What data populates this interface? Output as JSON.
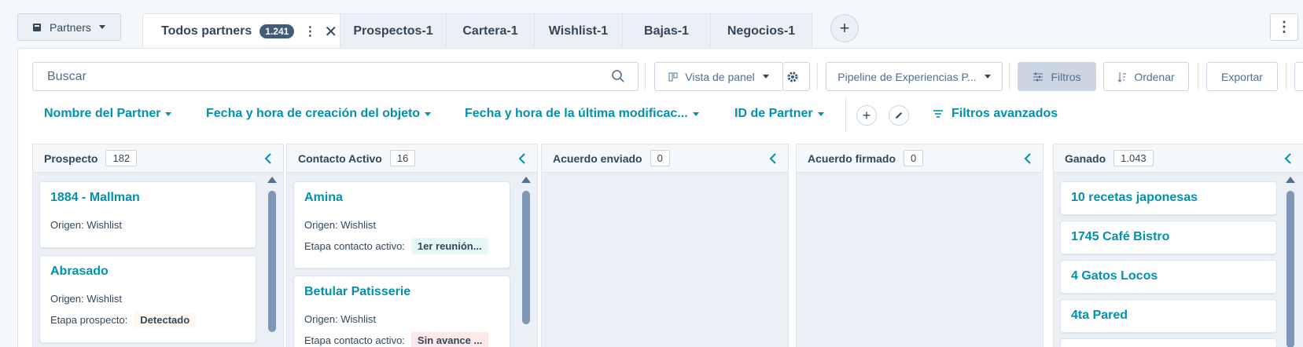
{
  "object_selector": {
    "label": "Partners"
  },
  "tabs": [
    {
      "label": "Todos partners",
      "count": "1.241"
    },
    {
      "label": "Prospectos-1"
    },
    {
      "label": "Cartera-1"
    },
    {
      "label": "Wishlist-1"
    },
    {
      "label": "Bajas-1"
    },
    {
      "label": "Negocios-1"
    }
  ],
  "toolbar": {
    "search_placeholder": "Buscar",
    "view_label": "Vista de panel",
    "pipeline_label": "Pipeline de Experiencias P...",
    "filters_label": "Filtros",
    "sort_label": "Ordenar",
    "export_label": "Exportar"
  },
  "filter_bar": {
    "filters": [
      "Nombre del Partner",
      "Fecha y hora de creación del objeto",
      "Fecha y hora de la última modificac...",
      "ID de Partner"
    ],
    "advanced_label": "Filtros avanzados"
  },
  "columns": [
    {
      "title": "Prospecto",
      "count": "182",
      "cards": [
        {
          "name": "1884 - Mallman",
          "origin": "Origen: Wishlist"
        },
        {
          "name": "Abrasado",
          "origin": "Origen: Wishlist",
          "stage_label": "Etapa prospecto:",
          "stage_value": "Detectado"
        }
      ]
    },
    {
      "title": "Contacto Activo",
      "count": "16",
      "cards": [
        {
          "name": "Amina",
          "origin": "Origen: Wishlist",
          "stage_label": "Etapa contacto activo:",
          "stage_value": "1er reunión..."
        },
        {
          "name": "Betular Patisserie",
          "origin": "Origen: Wishlist",
          "stage_label": "Etapa contacto activo:",
          "stage_value": "Sin avance ..."
        }
      ]
    },
    {
      "title": "Acuerdo enviado",
      "count": "0",
      "cards": []
    },
    {
      "title": "Acuerdo firmado",
      "count": "0",
      "cards": []
    },
    {
      "title": "Ganado",
      "count": "1.043",
      "cards": [
        {
          "name": "10 recetas japonesas"
        },
        {
          "name": "1745 Café Bistro"
        },
        {
          "name": "4 Gatos Locos"
        },
        {
          "name": "4ta Pared"
        }
      ]
    }
  ],
  "colors": {
    "accent": "#0091ae",
    "tag_green": "#e5f8f6",
    "tag_orange": "#fef8f0",
    "tag_red": "#fde9ea"
  }
}
